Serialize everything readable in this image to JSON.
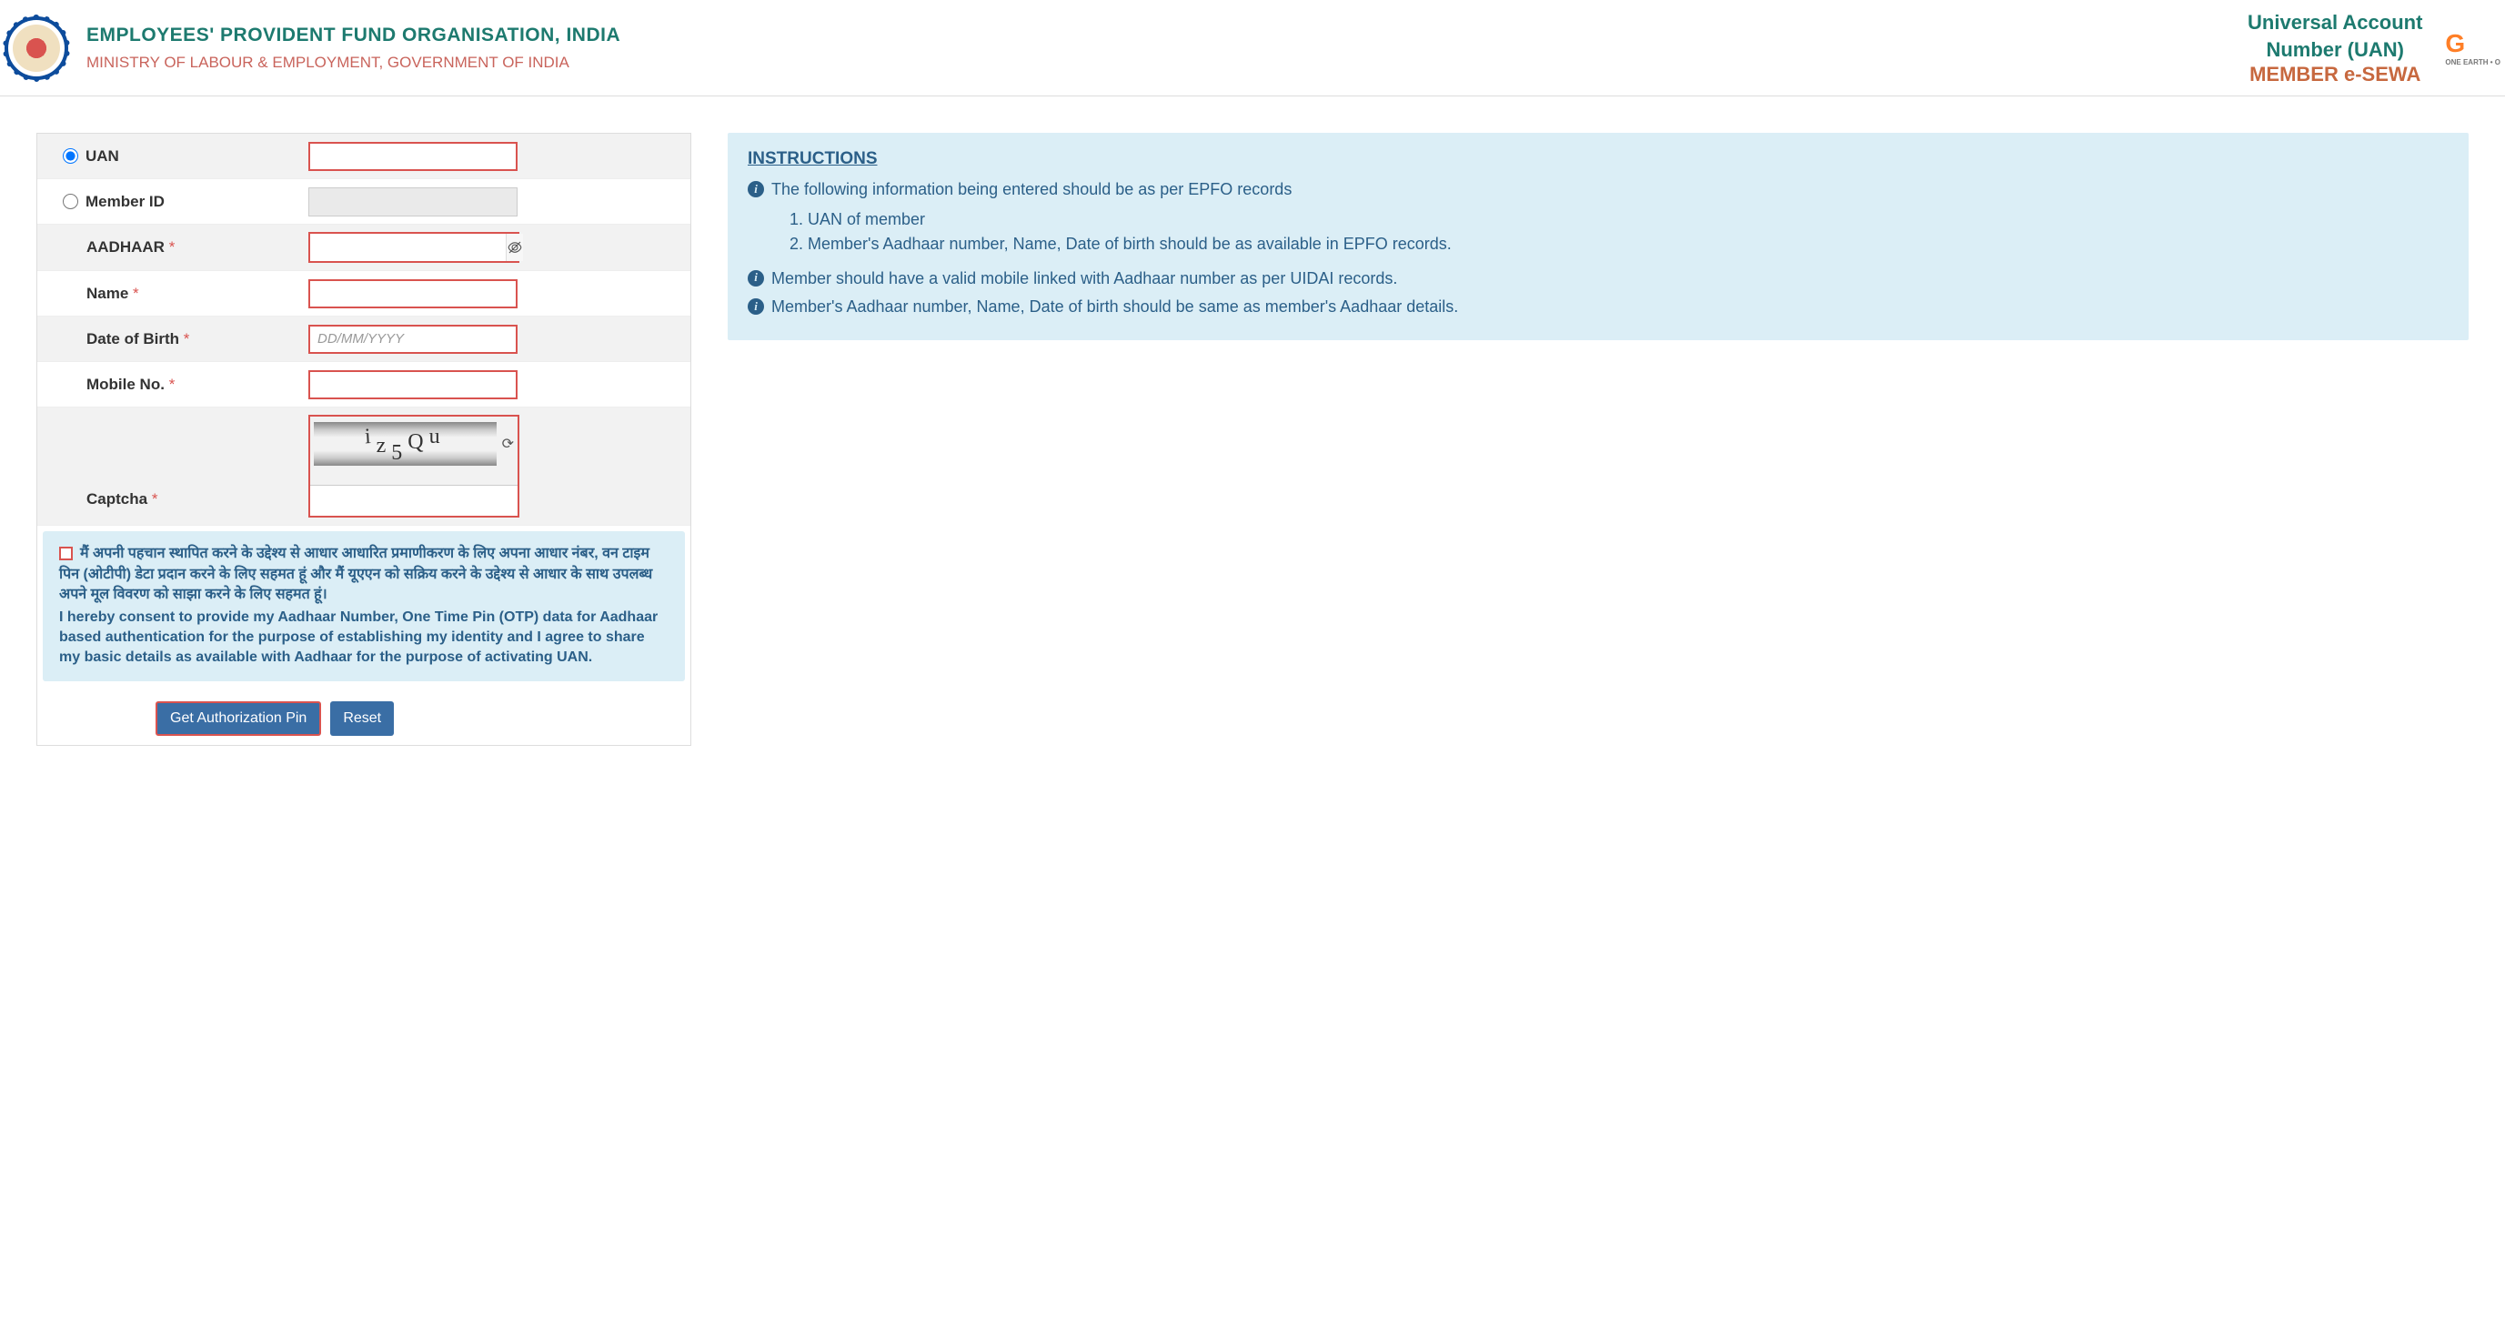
{
  "header": {
    "org_title": "EMPLOYEES' PROVIDENT FUND ORGANISATION, INDIA",
    "ministry": "MINISTRY OF LABOUR & EMPLOYMENT, GOVERNMENT OF INDIA",
    "uan_line1": "Universal Account",
    "uan_line2": "Number (UAN)",
    "member_sewa": "MEMBER e-SEWA",
    "g20": "G",
    "g20_sub": "ONE EARTH • O"
  },
  "form": {
    "uan_label": "UAN",
    "member_id_label": "Member ID",
    "aadhaar_label": "AADHAAR",
    "name_label": "Name",
    "dob_label": "Date of Birth",
    "dob_placeholder": "DD/MM/YYYY",
    "mobile_label": "Mobile No.",
    "captcha_label": "Captcha",
    "captcha_text": "iz5Qu",
    "selected_radio": "uan"
  },
  "consent": {
    "hindi": "मैं अपनी पहचान स्थापित करने के उद्देश्य से आधार आधारित प्रमाणीकरण के लिए अपना आधार नंबर, वन टाइम पिन (ओटीपी) डेटा प्रदान करने के लिए सहमत हूं और मैं यूएएन को सक्रिय करने के उद्देश्य से आधार के साथ उपलब्ध अपने मूल विवरण को साझा करने के लिए सहमत हूं।",
    "english": "I hereby consent to provide my Aadhaar Number, One Time Pin (OTP) data for Aadhaar based authentication for the purpose of establishing my identity and I agree to share my basic details as available with Aadhaar for the purpose of activating UAN."
  },
  "buttons": {
    "get_pin": "Get Authorization Pin",
    "reset": "Reset"
  },
  "instructions": {
    "title": "INSTRUCTIONS",
    "item1": "The following information being entered should be as per EPFO records",
    "sub1": "1. UAN of member",
    "sub2": "2. Member's Aadhaar number, Name, Date of birth should be as available in EPFO records.",
    "item2": "Member should have a valid mobile linked with Aadhaar number as per UIDAI records.",
    "item3": "Member's Aadhaar number, Name, Date of birth should be same as member's Aadhaar details."
  }
}
